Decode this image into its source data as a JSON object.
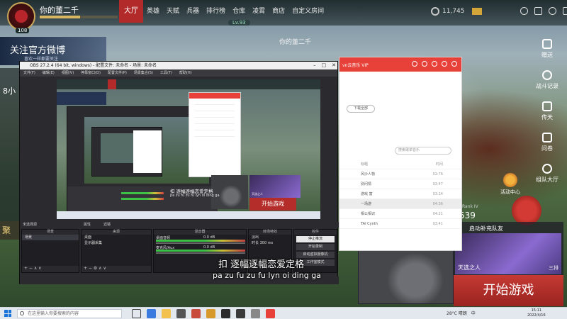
{
  "game": {
    "player_name": "你的董二千",
    "player_level": "108",
    "nav": [
      "大厅",
      "英雄",
      "天赋",
      "兵器",
      "排行榜",
      "仓库",
      "凌霄",
      "商店",
      "自定义房间"
    ],
    "level_badge": "Lv.93",
    "currency_value": "11,745",
    "center_name": "你的董二千",
    "weibo_title": "关注官方微博",
    "weibo_sub": "喜欢一样都要关注",
    "left_text": "8小",
    "left_gold": "聚",
    "right_buttons": [
      "赠送",
      "战斗记录",
      "传天",
      "问卷",
      "组队大厅"
    ],
    "event_label": "活动中心",
    "side_number": "539",
    "side_number_label": "Rank IV",
    "match_header": "启动补充队友",
    "match_card_name": "天选之人",
    "match_card_rank": "三排",
    "start_button": "开始游戏"
  },
  "player": {
    "logo": "vn云音乐 VIP",
    "download": "下载全部",
    "search_placeholder": "搜索歌单音乐",
    "header": {
      "title": "标题",
      "duration": "时间"
    },
    "songs": [
      {
        "title": "风沙人物",
        "duration": "02:76"
      },
      {
        "title": "别问情",
        "duration": "03:47"
      },
      {
        "title": "游戏 富",
        "duration": "03:24"
      },
      {
        "title": "一场游",
        "duration": "04:36"
      },
      {
        "title": "相公相识",
        "duration": "04:21"
      },
      {
        "title": "TAI Cynth",
        "duration": "03:41"
      }
    ]
  },
  "obs": {
    "title": "OBS 27.2.4 (64 bit, windows) - 配置文件: 未命名 - 场景: 未命名",
    "menu": [
      "文件(F)",
      "编辑(E)",
      "视图(V)",
      "停靠窗口(D)",
      "配置文件(P)",
      "场景集合(S)",
      "工具(T)",
      "帮助(H)"
    ],
    "selected_label": "未选择源",
    "props_button": "属性",
    "filters_button": "滤镜",
    "docks": {
      "scenes": "场景",
      "sources": "来源",
      "mixer": "混音器",
      "transitions": "转场特效",
      "controls": "控件"
    },
    "scene_items": [
      "场景"
    ],
    "source_items": [
      "桌面",
      "显示器采集"
    ],
    "mixer": [
      {
        "name": "桌面音频",
        "db": "0.0 dB"
      },
      {
        "name": "麦克风/Aux",
        "db": "0.0 dB"
      }
    ],
    "transition": {
      "type": "淡出",
      "duration_label": "时长",
      "duration": "300 ms"
    },
    "controls": [
      "停止推流",
      "开始录制",
      "启动虚拟摄像机",
      "工作室模式",
      "设置",
      "退出"
    ]
  },
  "lyrics": {
    "line1": "扣 逐幅逐幅恋爱定格",
    "line2": "pa zu fu zu fu lyn oi ding ga"
  },
  "taskbar": {
    "search_placeholder": "在这里输入你要搜索的内容",
    "weather": "28°C 晴朗",
    "time": "15:11",
    "date": "2022/4/16",
    "lang": "中"
  }
}
